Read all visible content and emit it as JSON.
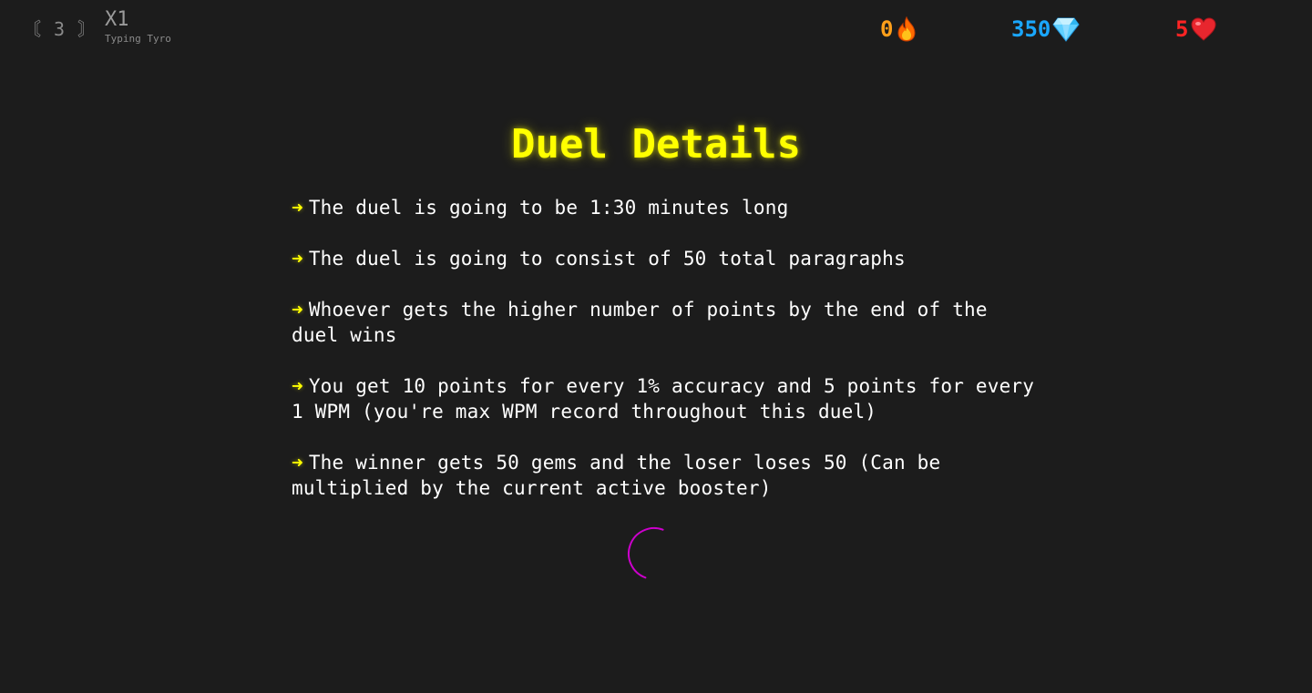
{
  "header": {
    "level_badge": "〘 3 〙",
    "multiplier": "X1",
    "rank_title": "Typing Tyro",
    "streak": {
      "value": "0",
      "icon": "fire-icon",
      "color": "#ff9f1a"
    },
    "gems": {
      "value": "350",
      "icon": "gem-icon",
      "color": "#1aa7ff"
    },
    "lives": {
      "value": "5",
      "icon": "heart-icon",
      "color": "#ff2424"
    }
  },
  "main": {
    "title": "Duel Details",
    "arrow": "➜",
    "rules": [
      {
        "text": "The duel is going to be 1:30 minutes long"
      },
      {
        "text": "The duel is going to consist of 50 total paragraphs"
      },
      {
        "text": "Whoever gets the higher number of points by the end of the duel wins"
      },
      {
        "text": "You get 10 points for every 1% accuracy and 5 points for every 1 WPM (you're max WPM record throughout this duel)"
      },
      {
        "text": "The winner gets 50 gems and the loser loses 50 (Can be multiplied by the current active booster)"
      }
    ]
  },
  "colors": {
    "background": "#1c1c1c",
    "accent": "#ffff00",
    "spinner": "#cc00cc"
  }
}
